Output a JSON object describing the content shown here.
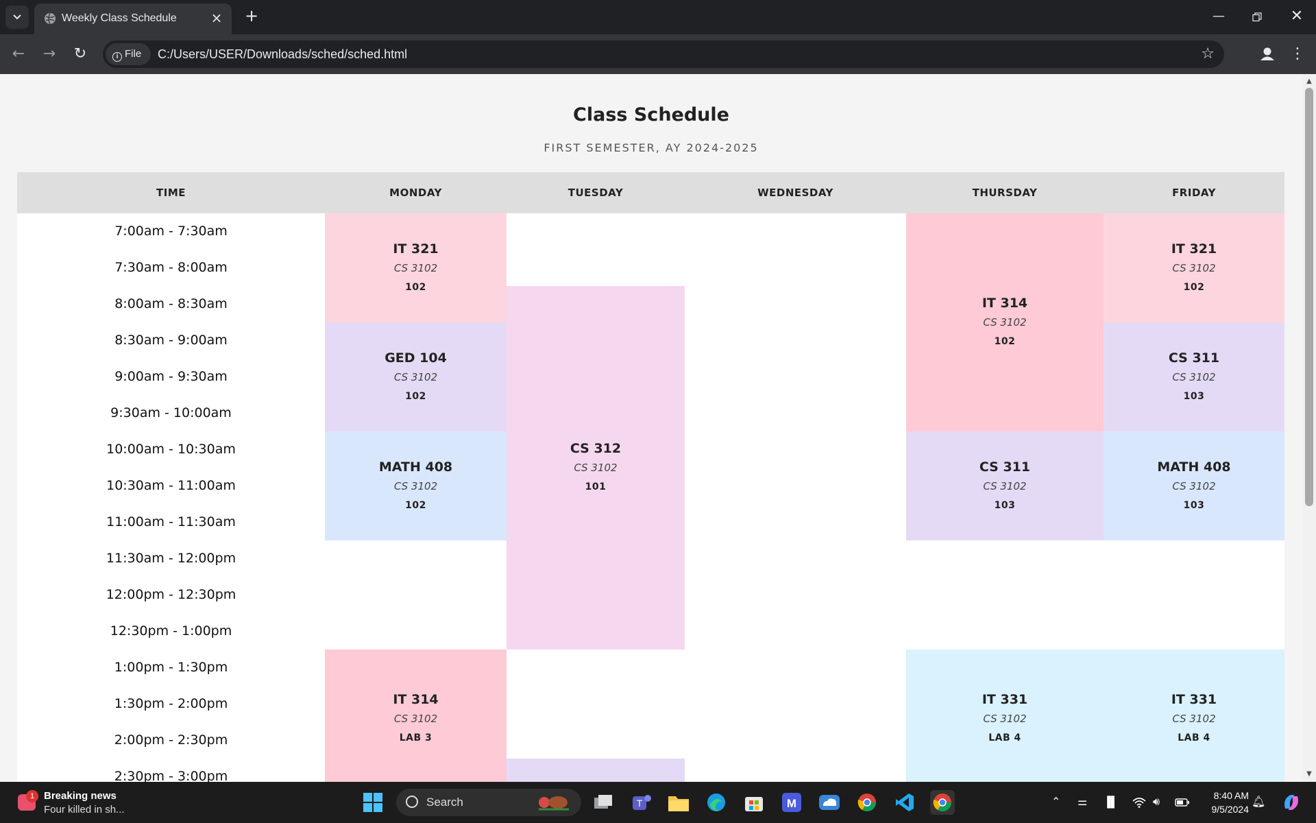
{
  "browser": {
    "tab_title": "Weekly Class Schedule",
    "chip_label": "File",
    "url": "C:/Users/USER/Downloads/sched/sched.html"
  },
  "page": {
    "title": "Class Schedule",
    "subtitle": "FIRST SEMESTER, AY 2024-2025",
    "headers": [
      "TIME",
      "MONDAY",
      "TUESDAY",
      "WEDNESDAY",
      "THURSDAY",
      "FRIDAY"
    ],
    "times": [
      "7:00am - 7:30am",
      "7:30am - 8:00am",
      "8:00am - 8:30am",
      "8:30am - 9:00am",
      "9:00am - 9:30am",
      "9:30am - 10:00am",
      "10:00am - 10:30am",
      "10:30am - 11:00am",
      "11:00am - 11:30am",
      "11:30am - 12:00pm",
      "12:00pm - 12:30pm",
      "12:30pm - 1:00pm",
      "1:00pm - 1:30pm",
      "1:30pm - 2:00pm",
      "2:00pm - 2:30pm",
      "2:30pm - 3:00pm"
    ],
    "classes": [
      {
        "day": 1,
        "start": 0,
        "span": 3,
        "code": "IT 321",
        "section": "CS 3102",
        "room": "102",
        "color": "#fdd5de"
      },
      {
        "day": 1,
        "start": 3,
        "span": 3,
        "code": "GED 104",
        "section": "CS 3102",
        "room": "102",
        "color": "#e4daf5"
      },
      {
        "day": 1,
        "start": 6,
        "span": 3,
        "code": "MATH 408",
        "section": "CS 3102",
        "room": "102",
        "color": "#d9e7fc"
      },
      {
        "day": 1,
        "start": 12,
        "span": 4,
        "code": "IT 314",
        "section": "CS 3102",
        "room": "LAB 3",
        "color": "#fdcad6"
      },
      {
        "day": 2,
        "start": 2,
        "span": 10,
        "code": "CS 312",
        "section": "CS 3102",
        "room": "101",
        "color": "#f5d8ef"
      },
      {
        "day": 2,
        "start": 15,
        "span": 1,
        "code": "",
        "section": "",
        "room": "",
        "color": "#e4daf5"
      },
      {
        "day": 4,
        "start": 0,
        "span": 6,
        "code": "IT 314",
        "section": "CS 3102",
        "room": "102",
        "color": "#fdcad6"
      },
      {
        "day": 4,
        "start": 6,
        "span": 3,
        "code": "CS 311",
        "section": "CS 3102",
        "room": "103",
        "color": "#e4daf5"
      },
      {
        "day": 4,
        "start": 12,
        "span": 4,
        "code": "IT 331",
        "section": "CS 3102",
        "room": "LAB 4",
        "color": "#d9f2fd"
      },
      {
        "day": 5,
        "start": 0,
        "span": 3,
        "code": "IT 321",
        "section": "CS 3102",
        "room": "102",
        "color": "#fdd5de"
      },
      {
        "day": 5,
        "start": 3,
        "span": 3,
        "code": "CS 311",
        "section": "CS 3102",
        "room": "103",
        "color": "#e4daf5"
      },
      {
        "day": 5,
        "start": 6,
        "span": 3,
        "code": "MATH 408",
        "section": "CS 3102",
        "room": "103",
        "color": "#d9e7fc"
      },
      {
        "day": 5,
        "start": 12,
        "span": 6,
        "code": "IT 331",
        "section": "CS 3102",
        "room": "LAB 4",
        "color": "#d9f2fd"
      }
    ]
  },
  "taskbar": {
    "news_title": "Breaking news",
    "news_text": "Four killed in sh...",
    "news_badge": "1",
    "search_label": "Search",
    "time": "8:40 AM",
    "date": "9/5/2024"
  }
}
